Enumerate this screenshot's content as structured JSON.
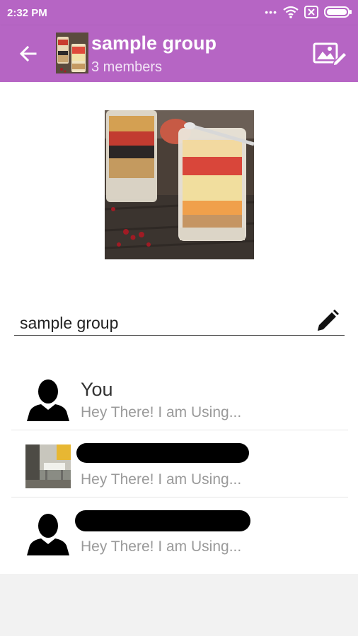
{
  "status_bar": {
    "time": "2:32 PM",
    "icons": [
      "more-dots-icon",
      "wifi-icon",
      "sim-error-icon",
      "battery-icon"
    ]
  },
  "app_bar": {
    "title": "sample group",
    "subtitle": "3 members",
    "icons": [
      "back-arrow-icon",
      "edit-photo-icon"
    ],
    "color": "#b665c4"
  },
  "group": {
    "name": "sample group"
  },
  "members": [
    {
      "name": "You",
      "status": "Hey There! I am Using...",
      "avatar": "person-silhouette-icon",
      "name_redacted": false
    },
    {
      "name": "",
      "status": "Hey There! I am Using...",
      "avatar": "photo",
      "name_redacted": true
    },
    {
      "name": "",
      "status": "Hey There! I am Using...",
      "avatar": "person-silhouette-icon",
      "name_redacted": true
    }
  ]
}
